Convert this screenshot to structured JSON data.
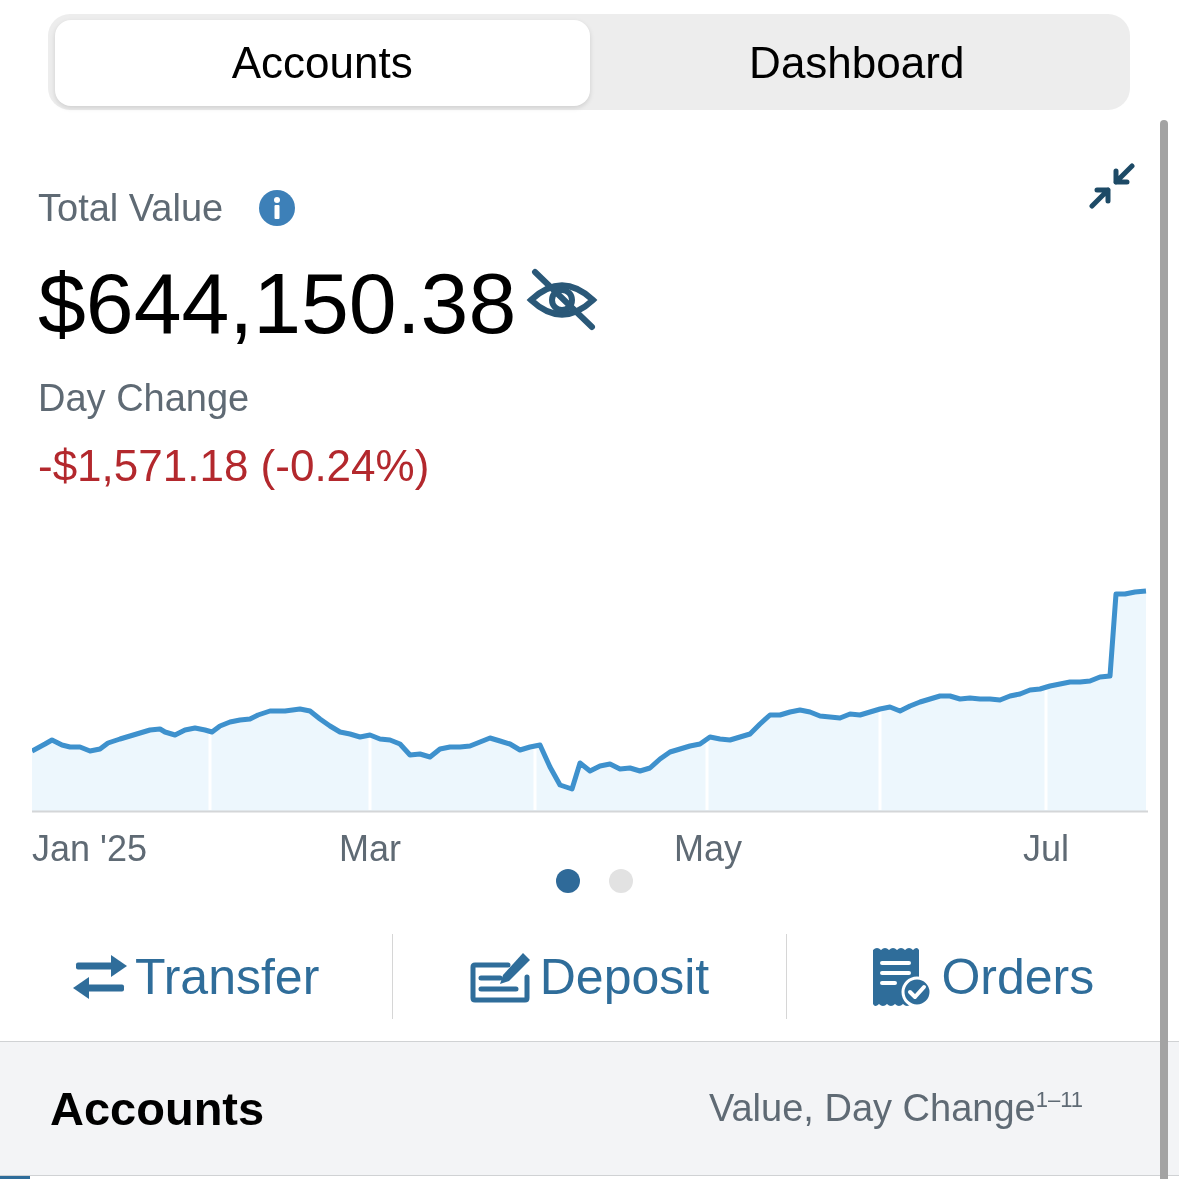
{
  "segmented_control": {
    "tabs": [
      {
        "label": "Accounts",
        "selected": true
      },
      {
        "label": "Dashboard",
        "selected": false
      }
    ]
  },
  "summary": {
    "title": "Total Value",
    "amount": "$644,150.38",
    "day_change_label": "Day Change",
    "day_change": "-$1,571.18 (-0.24%)",
    "negative": true
  },
  "chart": {
    "x_labels": [
      "Jan '25",
      "Mar",
      "May",
      "Jul"
    ]
  },
  "pager": [
    {
      "selected": true
    },
    {
      "selected": false
    }
  ],
  "actions": [
    {
      "label": "Transfer",
      "kind": "transfer"
    },
    {
      "label": "Deposit",
      "kind": "deposit"
    },
    {
      "label": "Orders",
      "kind": "orders"
    }
  ],
  "accounts_header": {
    "title": "Accounts",
    "columns_label": "Value, Day Change$^{1–11}$"
  }
}
